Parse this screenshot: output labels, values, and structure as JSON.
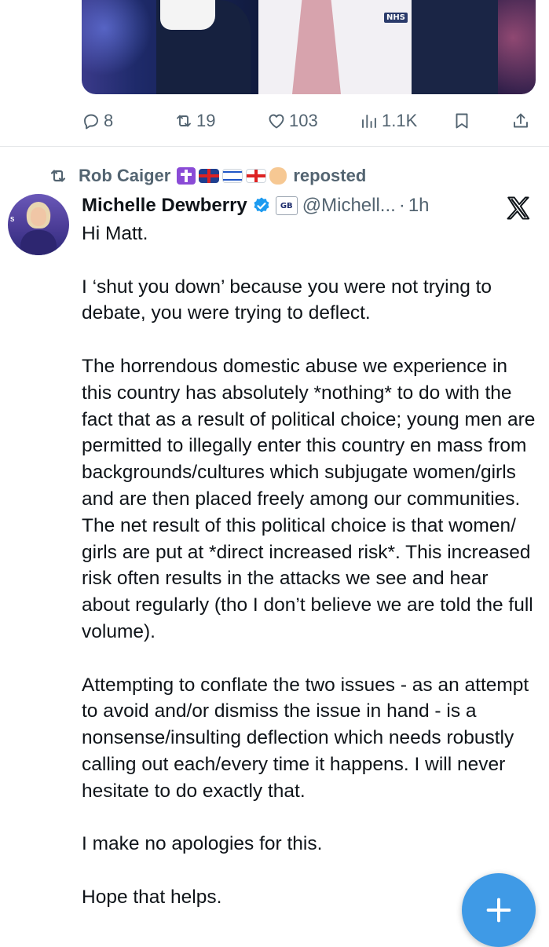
{
  "media": {
    "badge_text": "NHS"
  },
  "actions": {
    "replies": "8",
    "reposts": "19",
    "likes": "103",
    "views": "1.1K"
  },
  "repost_line": {
    "reposter": "Rob Caiger",
    "emoji_names": [
      "latin-cross",
      "uk-flag",
      "israel-flag",
      "england-flag",
      "raised-fist"
    ],
    "suffix": "reposted"
  },
  "author": {
    "name": "Michelle Dewberry",
    "affiliate_badge": "GB News",
    "handle": "@Michell...",
    "separator": "·",
    "time": "1h"
  },
  "body": {
    "paragraphs": [
      "Hi Matt.",
      "I ‘shut you down’ because you were not trying to debate, you were trying to deflect.",
      "The horrendous domestic abuse we experience in this country has absolutely *nothing* to do with the fact that as a result of political choice; young men are permitted to illegally enter this country en mass from backgrounds/cultures which subjugate women/girls and are then placed freely among our communities. The net result of this political choice is that women/ girls are put at *direct increased risk*. This increased risk often results in the attacks we see and hear about regularly (tho I don’t believe we are told the full volume).",
      "Attempting to conflate the two issues - as an attempt to avoid and/or dismiss the issue in hand - is a nonsense/insulting deflection which needs robustly calling out each/every time it happens. I will never hesitate to do exactly that.",
      "I make no apologies for this.",
      "Hope that helps."
    ]
  },
  "colors": {
    "text": "#0f1419",
    "secondary": "#536471",
    "verified": "#1d9bf0",
    "fab": "#3f9ae6"
  }
}
